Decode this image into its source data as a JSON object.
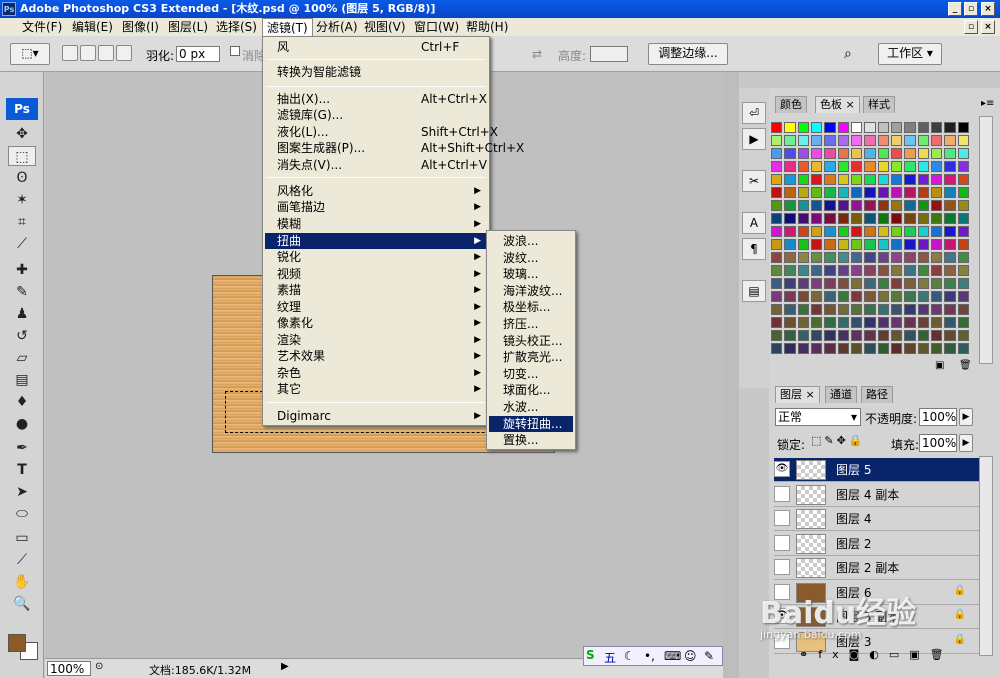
{
  "window": {
    "title": "Adobe Photoshop CS3 Extended - [木纹.psd @ 100% (图层 5, RGB/8)]",
    "ps_badge": "Ps"
  },
  "menubar": {
    "items": [
      "文件(F)",
      "编辑(E)",
      "图像(I)",
      "图层(L)",
      "选择(S)",
      "滤镜(T)",
      "分析(A)",
      "视图(V)",
      "窗口(W)",
      "帮助(H)"
    ],
    "active": "滤镜(T)"
  },
  "options": {
    "feather_label": "羽化:",
    "feather_value": "0 px",
    "antialias_label": "消除",
    "height_label": "高度:",
    "refine_button": "调整边缘...",
    "workspace_button": "工作区"
  },
  "filter_menu": {
    "items": [
      {
        "label": "风",
        "shortcut": "Ctrl+F"
      },
      {
        "label": "转换为智能滤镜"
      },
      {
        "label": "抽出(X)...",
        "shortcut": "Alt+Ctrl+X"
      },
      {
        "label": "滤镜库(G)..."
      },
      {
        "label": "液化(L)...",
        "shortcut": "Shift+Ctrl+X"
      },
      {
        "label": "图案生成器(P)...",
        "shortcut": "Alt+Shift+Ctrl+X"
      },
      {
        "label": "消失点(V)...",
        "shortcut": "Alt+Ctrl+V"
      },
      {
        "label": "风格化"
      },
      {
        "label": "画笔描边"
      },
      {
        "label": "模糊"
      },
      {
        "label": "扭曲"
      },
      {
        "label": "锐化"
      },
      {
        "label": "视频"
      },
      {
        "label": "素描"
      },
      {
        "label": "纹理"
      },
      {
        "label": "像素化"
      },
      {
        "label": "渲染"
      },
      {
        "label": "艺术效果"
      },
      {
        "label": "杂色"
      },
      {
        "label": "其它"
      },
      {
        "label": "Digimarc"
      }
    ],
    "highlighted": "扭曲"
  },
  "distort_submenu": {
    "items": [
      "波浪...",
      "波纹...",
      "玻璃...",
      "海洋波纹...",
      "极坐标...",
      "挤压...",
      "镜头校正...",
      "扩散亮光...",
      "切变...",
      "球面化...",
      "水波...",
      "旋转扭曲...",
      "置换..."
    ],
    "highlighted": "旋转扭曲..."
  },
  "swatches_panel": {
    "tabs": [
      "颜色",
      "色板",
      "样式"
    ],
    "active": "色板"
  },
  "layers_panel": {
    "tabs": [
      "图层",
      "通道",
      "路径"
    ],
    "active": "图层",
    "blend_mode": "正常",
    "opacity_label": "不透明度:",
    "opacity_value": "100%",
    "lock_label": "锁定:",
    "fill_label": "填充:",
    "fill_value": "100%",
    "layers": [
      {
        "name": "图层 5",
        "visible": true,
        "selected": true,
        "thumb": "checker"
      },
      {
        "name": "图层 4 副本",
        "visible": false,
        "selected": false,
        "thumb": "checker"
      },
      {
        "name": "图层 4",
        "visible": false,
        "selected": false,
        "thumb": "checker"
      },
      {
        "name": "图层 2",
        "visible": false,
        "selected": false,
        "thumb": "checker"
      },
      {
        "name": "图层 2 副本",
        "visible": false,
        "selected": false,
        "thumb": "checker"
      },
      {
        "name": "图层 6",
        "visible": false,
        "selected": false,
        "thumb": "brown",
        "locked": true
      },
      {
        "name": "图层 3 副本",
        "visible": true,
        "selected": false,
        "thumb": "brown",
        "locked": true
      },
      {
        "name": "图层 3",
        "visible": false,
        "selected": false,
        "thumb": "tan",
        "locked": true
      }
    ]
  },
  "status": {
    "zoom": "100%",
    "doc_info": "文档:185.6K/1.32M"
  },
  "ime": {
    "label": "五"
  },
  "watermark": {
    "text": "Baidu经验",
    "url": "jingyan.baidu.com"
  },
  "colors": {
    "selection": "#0a246a",
    "fg_swatch": "#8a5a2a",
    "bg_swatch": "#ffffff"
  }
}
